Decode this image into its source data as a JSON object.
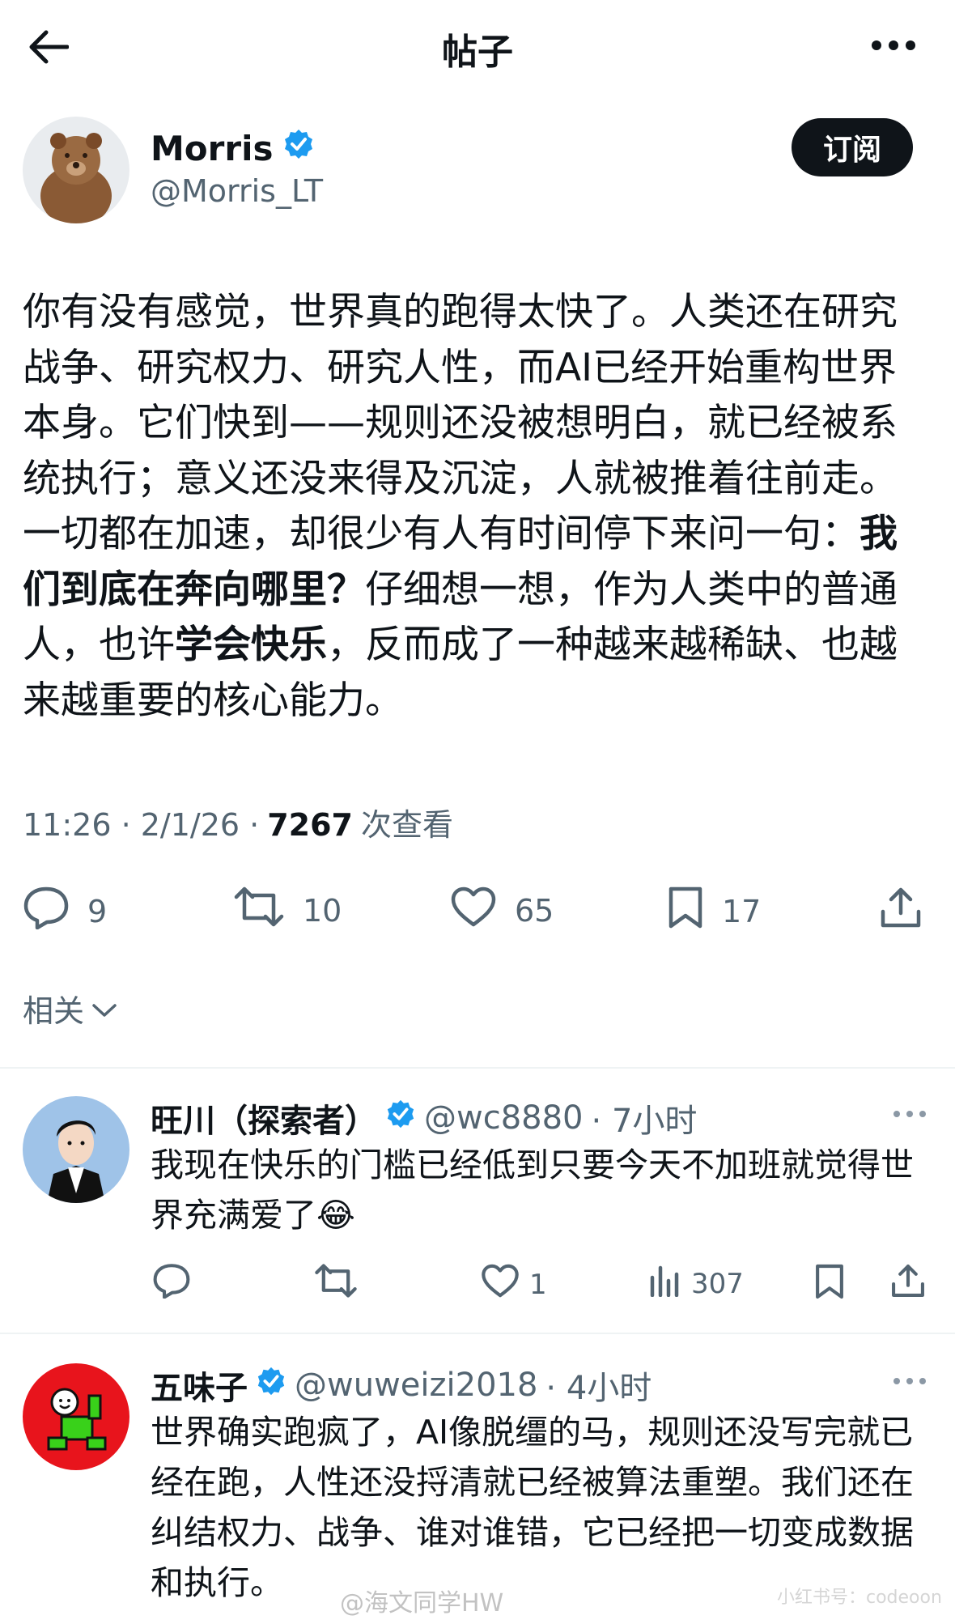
{
  "header": {
    "title": "帖子"
  },
  "post": {
    "author_name": "Morris",
    "author_handle": "@Morris_LT",
    "subscribe_label": "订阅",
    "text_part1": "你有没有感觉，世界真的跑得太快了。人类还在研究战争、研究权力、研究人性，而AI已经开始重构世界本身。它们快到——规则还没被想明白，就已经被系统执行；意义还没来得及沉淀，人就被推着往前走。一切都在加速，却很少有人有时间停下来问一句：",
    "text_bold1": "我们到底在奔向哪里？",
    "text_part2": "仔细想一想，作为人类中的普通人，也许",
    "text_bold2": "学会快乐",
    "text_part3": "，反而成了一种越来越稀缺、也越来越重要的核心能力。",
    "time": "11:26 · 2/1/26 ·",
    "views": "7267",
    "views_label": "次查看",
    "replies": "9",
    "reposts": "10",
    "likes": "65",
    "bookmarks": "17"
  },
  "related_label": "相关",
  "comments": [
    {
      "name": "旺川（探索者）",
      "handle": "@wc8880",
      "time": "· 7小时",
      "text": "我现在快乐的门槛已经低到只要今天不加班就觉得世界充满爱了😂",
      "replies": "",
      "reposts": "",
      "likes": "1",
      "views": "307"
    },
    {
      "name": "五味子",
      "handle": "@wuweizi2018",
      "time": "· 4小时",
      "text": "世界确实跑疯了，AI像脱缰的马，规则还没写完就已经在跑，人性还没捋清就已经被算法重塑。我们还在纠结权力、战争、谁对谁错，它已经把一切变成数据和执行。"
    }
  ],
  "watermark": "@海文同学HW",
  "watermark2": "小红书号：codeoon",
  "colors": {
    "verified": "#1d9bf0",
    "muted": "#536471",
    "text": "#0f1419"
  }
}
